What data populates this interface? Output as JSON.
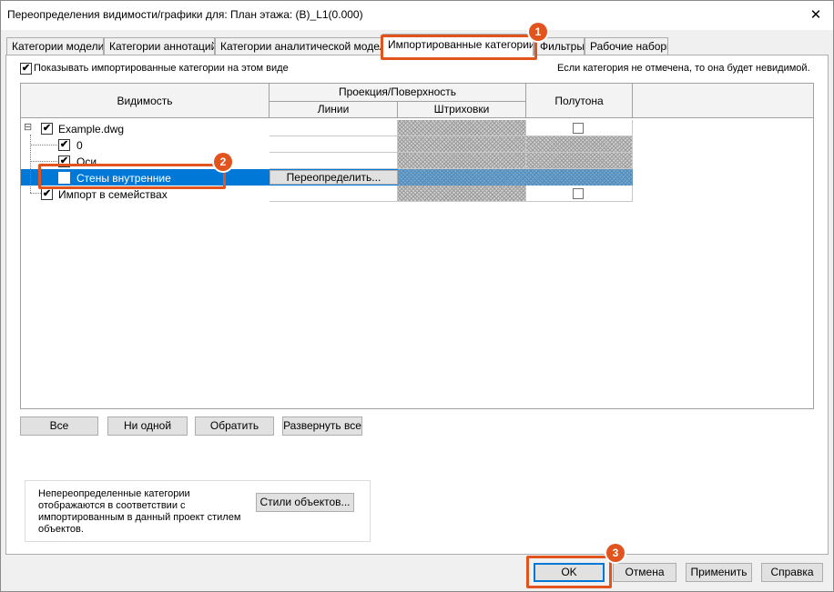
{
  "window": {
    "title": "Переопределения видимости/графики для: План этажа: (B)_L1(0.000)",
    "close_glyph": "✕"
  },
  "tabs": [
    {
      "label": "Категории модели"
    },
    {
      "label": "Категории аннотаций"
    },
    {
      "label": "Категории аналитической модели"
    },
    {
      "label": "Импортированные категории",
      "active": true
    },
    {
      "label": "Фильтры"
    },
    {
      "label": "Рабочие наборы"
    }
  ],
  "show_imported": {
    "label": "Показывать импортированные категории на этом виде",
    "checked": true
  },
  "hint": "Если категория не отмечена, то она будет невидимой.",
  "grid": {
    "headers": {
      "visibility": "Видимость",
      "projection": "Проекция/Поверхность",
      "lines": "Линии",
      "patterns": "Штриховки",
      "halftone": "Полутона"
    },
    "rows": [
      {
        "label": "Example.dwg",
        "checked": true,
        "expand": "⊟",
        "halftone": false
      },
      {
        "label": "0",
        "checked": true
      },
      {
        "label": "Оси",
        "checked": true
      },
      {
        "label": "Стены внутренние",
        "checked": false,
        "selected": true,
        "override_label": "Переопределить..."
      },
      {
        "label": "Импорт в семействах",
        "checked": true,
        "halftone": false
      }
    ]
  },
  "actions": {
    "all": "Все",
    "none": "Ни одной",
    "invert": "Обратить",
    "expand_all": "Развернуть все"
  },
  "note": {
    "text": "Непереопределенные категории отображаются в соответствии с импортированным в данный проект стилем объектов.",
    "object_styles_label": "Стили объектов..."
  },
  "footer": {
    "ok": "OK",
    "cancel": "Отмена",
    "apply": "Применить",
    "help": "Справка"
  },
  "callouts": [
    "1",
    "2",
    "3"
  ],
  "colors": {
    "selection": "#0078d7",
    "callout": "#e2541e"
  },
  "check_glyph": "✔"
}
